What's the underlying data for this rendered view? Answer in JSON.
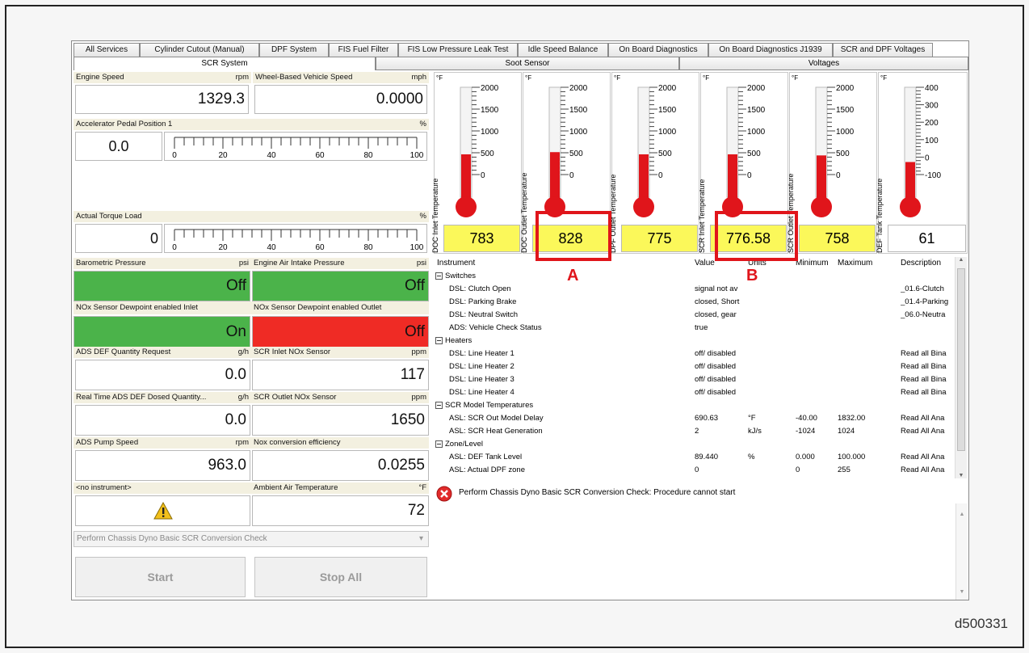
{
  "tabs_row1": [
    "All Services",
    "Cylinder Cutout (Manual)",
    "DPF System",
    "FIS Fuel Filter",
    "FIS Low Pressure Leak Test",
    "Idle Speed Balance",
    "On Board Diagnostics",
    "On Board Diagnostics J1939",
    "SCR and DPF Voltages"
  ],
  "tabs_row2": [
    "SCR System",
    "Soot Sensor",
    "Voltages"
  ],
  "left": {
    "engine_speed": {
      "label": "Engine Speed",
      "unit": "rpm",
      "value": "1329.3"
    },
    "vehicle_speed": {
      "label": "Wheel-Based Vehicle Speed",
      "unit": "mph",
      "value": "0.0000"
    },
    "accel": {
      "label": "Accelerator Pedal Position 1",
      "unit": "%",
      "value": "0.0"
    },
    "torque": {
      "label": "Actual Torque Load",
      "unit": "%",
      "value": "0"
    },
    "scale_ticks": [
      "0",
      "20",
      "40",
      "60",
      "80",
      "100"
    ],
    "baro": {
      "label": "Barometric Pressure",
      "unit": "psi",
      "value": "Off"
    },
    "intake": {
      "label": "Engine Air Intake Pressure",
      "unit": "psi",
      "value": "Off"
    },
    "nox_in_dew": {
      "label": "NOx Sensor Dewpoint enabled Inlet",
      "value": "On"
    },
    "nox_out_dew": {
      "label": "NOx Sensor Dewpoint enabled Outlet",
      "value": "Off"
    },
    "def_req": {
      "label": "ADS DEF Quantity Request",
      "unit": "g/h",
      "value": "0.0"
    },
    "scr_in_nox": {
      "label": "SCR Inlet NOx Sensor",
      "unit": "ppm",
      "value": "117"
    },
    "def_dosed": {
      "label": "Real Time ADS DEF Dosed Quantity...",
      "unit": "g/h",
      "value": "0.0"
    },
    "scr_out_nox": {
      "label": "SCR Outlet NOx Sensor",
      "unit": "ppm",
      "value": "1650"
    },
    "pump": {
      "label": "ADS Pump Speed",
      "unit": "rpm",
      "value": "963.0"
    },
    "nox_eff": {
      "label": "Nox conversion efficiency",
      "value": "0.0255"
    },
    "no_instr": {
      "label": "<no instrument>"
    },
    "ambient": {
      "label": "Ambient Air Temperature",
      "unit": "°F",
      "value": "72"
    },
    "procedure": "Perform Chassis Dyno Basic SCR Conversion Check",
    "start": "Start",
    "stop_all": "Stop All"
  },
  "gauges": [
    {
      "name": "DOC Inlet Temperature",
      "unit": "°F",
      "ticks": [
        "2000",
        "1500",
        "1000",
        "500",
        "0"
      ],
      "value": "783",
      "level": 0.39
    },
    {
      "name": "DOC Outlet Temperature",
      "unit": "°F",
      "ticks": [
        "2000",
        "1500",
        "1000",
        "500",
        "0"
      ],
      "value": "828",
      "level": 0.41
    },
    {
      "name": "DPF Outlet Temperature",
      "unit": "°F",
      "ticks": [
        "2000",
        "1500",
        "1000",
        "500",
        "0"
      ],
      "value": "775",
      "level": 0.39
    },
    {
      "name": "SCR Inlet Temperature",
      "unit": "°F",
      "ticks": [
        "2000",
        "1500",
        "1000",
        "500",
        "0"
      ],
      "value": "776.58",
      "level": 0.39
    },
    {
      "name": "SCR Outlet Temperature",
      "unit": "°F",
      "ticks": [
        "2000",
        "1500",
        "1000",
        "500",
        "0"
      ],
      "value": "758",
      "level": 0.38
    },
    {
      "name": "DEF Tank Temperature",
      "unit": "°F",
      "ticks": [
        "400",
        "300",
        "200",
        "100",
        "0",
        "-100"
      ],
      "value": "61",
      "level": 0.32
    }
  ],
  "table": {
    "headers": [
      "Instrument",
      "Value",
      "Units",
      "Minimum",
      "Maximum",
      "Description"
    ],
    "rows": [
      {
        "group": "Switches"
      },
      {
        "name": "DSL: Clutch Open",
        "value": "signal not av",
        "units": "",
        "min": "",
        "max": "",
        "desc": "_01.6-Clutch"
      },
      {
        "name": "DSL: Parking Brake",
        "value": "closed, Short",
        "units": "",
        "min": "",
        "max": "",
        "desc": "_01.4-Parking"
      },
      {
        "name": "DSL: Neutral Switch",
        "value": "closed, gear",
        "units": "",
        "min": "",
        "max": "",
        "desc": "_06.0-Neutra"
      },
      {
        "name": "ADS: Vehicle Check Status",
        "value": "true",
        "units": "",
        "min": "",
        "max": "",
        "desc": ""
      },
      {
        "group": "Heaters"
      },
      {
        "name": "DSL: Line Heater 1",
        "value": "off/ disabled",
        "units": "",
        "min": "",
        "max": "",
        "desc": "Read all Bina"
      },
      {
        "name": "DSL: Line Heater 2",
        "value": "off/ disabled",
        "units": "",
        "min": "",
        "max": "",
        "desc": "Read all Bina"
      },
      {
        "name": "DSL: Line Heater 3",
        "value": "off/ disabled",
        "units": "",
        "min": "",
        "max": "",
        "desc": "Read all Bina"
      },
      {
        "name": "DSL: Line Heater 4",
        "value": "off/ disabled",
        "units": "",
        "min": "",
        "max": "",
        "desc": "Read all Bina"
      },
      {
        "group": "SCR Model Temperatures"
      },
      {
        "name": "ASL: SCR Out Model Delay",
        "value": "690.63",
        "units": "°F",
        "min": "-40.00",
        "max": "1832.00",
        "desc": "Read All Ana"
      },
      {
        "name": "ASL: SCR Heat Generation",
        "value": "2",
        "units": "kJ/s",
        "min": "-1024",
        "max": "1024",
        "desc": "Read All Ana"
      },
      {
        "group": "Zone/Level"
      },
      {
        "name": "ASL: DEF Tank Level",
        "value": "89.440",
        "units": "%",
        "min": "0.000",
        "max": "100.000",
        "desc": "Read All Ana"
      },
      {
        "name": "ASL: Actual DPF zone",
        "value": "0",
        "units": "",
        "min": "0",
        "max": "255",
        "desc": "Read All Ana"
      }
    ]
  },
  "message": "Perform Chassis Dyno Basic SCR Conversion Check: Procedure cannot start",
  "annotations": {
    "a": "A",
    "b": "B"
  },
  "figure_id": "d500331",
  "colors": {
    "green": "#4bb34a",
    "red": "#ef2b25",
    "yellow": "#fbf85a",
    "thermo": "#e0151b",
    "annot": "#e0151b"
  }
}
